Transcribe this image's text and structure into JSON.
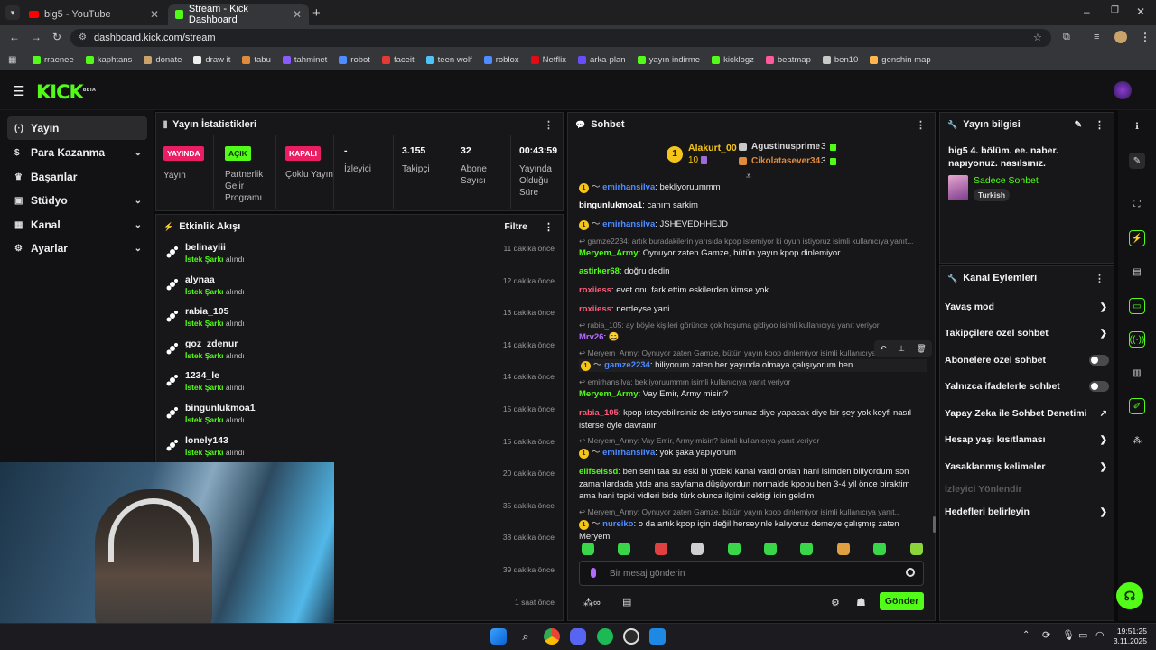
{
  "browser": {
    "tabs": [
      {
        "label": "big5 - YouTube"
      },
      {
        "label": "Stream - Kick Dashboard"
      }
    ],
    "url": "dashboard.kick.com/stream",
    "bookmarks": [
      "rraenee",
      "kaphtans",
      "donate",
      "draw it",
      "tabu",
      "tahminet",
      "robot",
      "faceit",
      "teen wolf",
      "roblox",
      "Netflix",
      "arka-plan",
      "yayın indirme",
      "kicklogz",
      "beatmap",
      "ben10",
      "genshin map"
    ]
  },
  "app": {
    "logo": "KICK",
    "logo_sup": "BETA"
  },
  "nav": [
    {
      "label": "Yayın",
      "icon": "(·)"
    },
    {
      "label": "Para Kazanma",
      "icon": "$"
    },
    {
      "label": "Başarılar",
      "icon": "♛"
    },
    {
      "label": "Stüdyo",
      "icon": "▣"
    },
    {
      "label": "Kanal",
      "icon": "▦"
    },
    {
      "label": "Ayarlar",
      "icon": "⚙"
    }
  ],
  "stats": {
    "title": "Yayın İstatistikleri",
    "items": [
      {
        "badge": "YAYINDA",
        "label": "Yayın"
      },
      {
        "badge": "AÇIK",
        "label": "Partnerlik Gelir Programı"
      },
      {
        "badge": "KAPALI",
        "label": "Çoklu Yayın"
      },
      {
        "value": "-",
        "label": "İzleyici"
      },
      {
        "value": "3.155",
        "label": "Takipçi"
      },
      {
        "value": "32",
        "label": "Abone Sayısı"
      },
      {
        "value": "00:43:59",
        "label": "Yayında Olduğu Süre"
      }
    ]
  },
  "feed": {
    "title": "Etkinlik Akışı",
    "filter": "Filtre",
    "action_strong": "İstek Şarkı",
    "action_rest": " alındı",
    "rows": [
      {
        "name": "belinayiii",
        "time": "11 dakika önce"
      },
      {
        "name": "alynaa",
        "time": "12 dakika önce"
      },
      {
        "name": "rabia_105",
        "time": "13 dakika önce"
      },
      {
        "name": "goz_zdenur",
        "time": "14 dakika önce"
      },
      {
        "name": "1234_le",
        "time": "14 dakika önce"
      },
      {
        "name": "bingunlukmoa1",
        "time": "15 dakika önce"
      },
      {
        "name": "lonely143",
        "time": "15 dakika önce"
      },
      {
        "name": "",
        "time": "20 dakika önce"
      },
      {
        "name": "",
        "time": "35 dakika önce"
      },
      {
        "name": "",
        "time": "38 dakika önce"
      },
      {
        "name": "",
        "time": "39 dakika önce"
      },
      {
        "name": "",
        "time": "1 saat önce"
      }
    ]
  },
  "chat": {
    "title": "Sohbet",
    "top_gifter": {
      "name": "Alakurt_00",
      "count": "10"
    },
    "gifters": [
      {
        "name": "Agustinusprime",
        "count": "3"
      },
      {
        "name": "Cikolatasever34",
        "count": "3"
      }
    ],
    "messages": [
      {
        "user": "emirhansilva",
        "text": ": bekliyoruummm",
        "color": "#4f8cff"
      },
      {
        "user": "bingunlukmoa1",
        "text": ": canım sarkim",
        "color": "#ffffff"
      },
      {
        "user": "emirhansilva",
        "text": ": JSHEVEDHHEJD",
        "color": "#4f8cff"
      },
      {
        "reply": "gamze2234: artık buradakilerin yarısıda kpop istemiyor ki oyun istiyoruz isimli kullanıcıya yanıt..."
      },
      {
        "user": "Meryem_Army",
        "text": ": Oynuyor zaten Gamze, bütün yayın kpop dinlemiyor",
        "color": "#53fc18"
      },
      {
        "user": "astirker68",
        "text": ": doğru dedin",
        "color": "#53fc18"
      },
      {
        "user": "roxiiess",
        "text": ": evet onu fark ettim eskilerden kimse yok",
        "color": "#ff5a7a"
      },
      {
        "user": "roxiiess",
        "text": ": nerdeyse yani",
        "color": "#ff5a7a"
      },
      {
        "reply": "rabia_105: ay böyle kişileri görünce çok hoşuma gidiyoo isimli kullanıcıya yanıt veriyor"
      },
      {
        "user": "Mrv26",
        "text": ": 😄",
        "color": "#b36bff"
      },
      {
        "reply": "Meryem_Army: Oynuyor zaten Gamze, bütün yayın kpop dinlemiyor isimli kullanıcıya"
      },
      {
        "user": "gamze2234",
        "text": ": biliyorum zaten her yayında olmaya çalışıyorum ben",
        "color": "#4f8cff"
      },
      {
        "reply": "emirhansilva: bekliyoruummm isimli kullanıcıya yanıt veriyor"
      },
      {
        "user": "Meryem_Army",
        "text": ": Vay Emir, Army misin?",
        "color": "#53fc18"
      },
      {
        "user": "rabia_105",
        "text": ": kpop isteyebilirsiniz de istiyorsunuz diye yapacak diye bir şey yok keyfi nasıl isterse öyle davranır",
        "color": "#ff5a7a"
      },
      {
        "reply": "Meryem_Army: Vay Emir, Army misin? isimli kullanıcıya yanıt veriyor"
      },
      {
        "user": "emirhansilva",
        "text": ": yok şaka yapıyorum",
        "color": "#4f8cff"
      },
      {
        "user": "elifselssd",
        "text": ": ben seni taa su eski bi ytdeki kanal vardi ordan hani isimden biliyordum son zamanlardada ytde ana sayfama düşüyordun normalde kpopu ben 3-4 yil önce biraktim ama hani tepki vidleri bide türk olunca ilgimi cektigi icin geldim",
        "color": "#53fc18"
      },
      {
        "reply": "Meryem_Army: Oynuyor zaten Gamze, bütün yayın kpop dinlemiyor isimli kullanıcıya yanıt..."
      },
      {
        "user": "nureiko",
        "text": ": o da artık kpop için değil herseyinle kalıyoruz demeye çalışmış zaten Meryem",
        "color": "#4f8cff"
      }
    ],
    "input_placeholder": "Bir mesaj gönderin",
    "send_label": "Gönder"
  },
  "streaminfo": {
    "title": "Yayın bilgisi",
    "stream_title": "big5 4. bölüm. ee. naber. napıyonuz. nasılsınız.",
    "category": "Sadece Sohbet",
    "tag": "Turkish"
  },
  "actions": {
    "title": "Kanal Eylemleri",
    "items": [
      {
        "label": "Yavaş mod",
        "kind": "chevron"
      },
      {
        "label": "Takipçilere özel sohbet",
        "kind": "chevron"
      },
      {
        "label": "Abonelere özel sohbet",
        "kind": "toggle"
      },
      {
        "label": "Yalnızca ifadelerle sohbet",
        "kind": "toggle"
      },
      {
        "label": "Yapay Zeka ile Sohbet Denetimi",
        "kind": "external"
      },
      {
        "label": "Hesap yaşı kısıtlaması",
        "kind": "chevron"
      },
      {
        "label": "Yasaklanmış kelimeler",
        "kind": "chevron"
      },
      {
        "label": "İzleyici Yönlendir",
        "kind": "disabled"
      },
      {
        "label": "Hedefleri belirleyin",
        "kind": "chevron"
      }
    ]
  },
  "taskbar": {
    "time": "19:51:25",
    "date": "3.11.2025"
  },
  "colors": {
    "accent": "#53fc18",
    "live_badge": "#e91e63",
    "bg": "#0a0a0b",
    "panel": "#17171a"
  }
}
